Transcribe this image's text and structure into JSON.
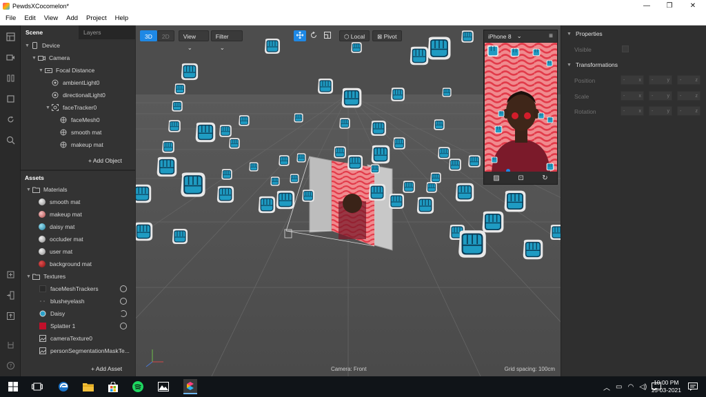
{
  "window": {
    "title": "PewdsXCocomelon*",
    "controls": {
      "minimize": "—",
      "maximize": "❐",
      "close": "✕"
    }
  },
  "menu": [
    "File",
    "Edit",
    "View",
    "Add",
    "Project",
    "Help"
  ],
  "scene_panel": {
    "tabs": [
      "Scene",
      "Layers"
    ],
    "tree": [
      {
        "label": "Device",
        "level": 0,
        "expanded": true,
        "icon": "device-icon"
      },
      {
        "label": "Camera",
        "level": 1,
        "expanded": true,
        "icon": "camera-icon"
      },
      {
        "label": "Focal Distance",
        "level": 2,
        "expanded": true,
        "icon": "focal-distance-icon"
      },
      {
        "label": "ambientLight0",
        "level": 3,
        "icon": "light-icon"
      },
      {
        "label": "directionalLight0",
        "level": 3,
        "icon": "light-icon"
      },
      {
        "label": "faceTracker0",
        "level": 3,
        "expanded": true,
        "icon": "face-tracker-icon"
      },
      {
        "label": "faceMesh0",
        "level": 4,
        "icon": "mesh-icon"
      },
      {
        "label": "smooth mat",
        "level": 4,
        "icon": "mesh-icon"
      },
      {
        "label": "makeup mat",
        "level": 4,
        "icon": "mesh-icon"
      }
    ],
    "add_object": "Add Object"
  },
  "assets_panel": {
    "title": "Assets",
    "materials_folder": "Materials",
    "materials": [
      {
        "label": "smooth mat",
        "color": "#bdbdbd"
      },
      {
        "label": "makeup mat",
        "color": "#d98b8b"
      },
      {
        "label": "daisy mat",
        "color": "#3fa9c9"
      },
      {
        "label": "occluder mat",
        "color": "#bdbdbd"
      },
      {
        "label": "user mat",
        "color": "#bdbdbd"
      },
      {
        "label": "background mat",
        "color": "#b71c1c"
      }
    ],
    "textures_folder": "Textures",
    "textures": [
      {
        "label": "faceMeshTrackers",
        "ring": true
      },
      {
        "label": "blusheyelash",
        "ring": true
      },
      {
        "label": "Daisy",
        "ring": true
      },
      {
        "label": "Splatter 1",
        "ring": true
      },
      {
        "label": "cameraTexture0",
        "ring": false
      },
      {
        "label": "personSegmentationMaskTe...",
        "ring": false
      }
    ],
    "add_asset": "Add Asset"
  },
  "viewport": {
    "mode_3d": "3D",
    "mode_2d": "2D",
    "view_dropdown": "View",
    "filter_dropdown": "Filter",
    "local": "Local",
    "pivot": "Pivot",
    "camera_label": "Camera: Front",
    "grid_spacing": "Grid spacing: 100cm"
  },
  "simulator": {
    "device": "iPhone 8"
  },
  "properties": {
    "title": "Properties",
    "visible_label": "Visible",
    "transformations_title": "Transformations",
    "rows": [
      "Position",
      "Scale",
      "Rotation"
    ],
    "axis": [
      "x",
      "y",
      "z"
    ]
  },
  "taskbar": {
    "time": "10:00 PM",
    "date": "15-03-2021"
  },
  "colors": {
    "accent": "#1e88e5",
    "sticker_blue": "#1f9bc2",
    "sticker_dark": "#0b3d57",
    "pink_bg": "#f08a8e"
  }
}
